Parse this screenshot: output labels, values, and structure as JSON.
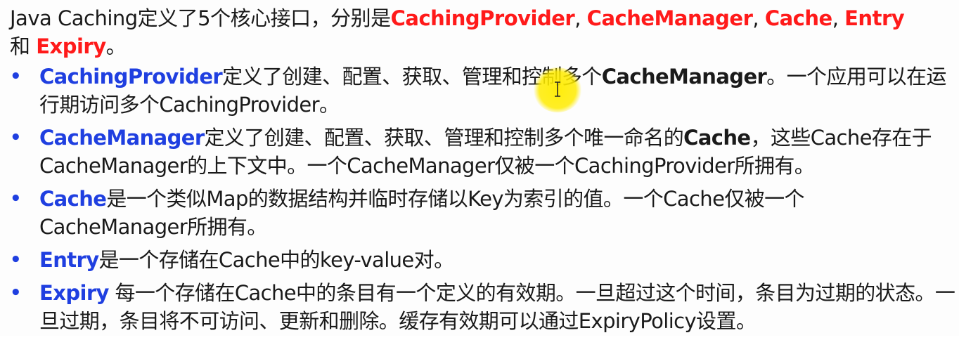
{
  "intro": {
    "prefix": "Java Caching定义了5个核心接口，分别是",
    "terms": [
      "CachingProvider",
      "CacheManager",
      "Cache",
      "Entry",
      "Expiry"
    ],
    "sep1": ", ",
    "sep2": ", ",
    "sep3": ", ",
    "line2_prefix": "和 ",
    "suffix": "。"
  },
  "bullets": [
    {
      "term": "CachingProvider",
      "text1": "定义了创建、配置、获取、管理和控制多个",
      "bold": "CacheManager",
      "text2": "。一个应用可以在运行期访问多个CachingProvider。"
    },
    {
      "term": "CacheManager",
      "text1": "定义了创建、配置、获取、管理和控制多个唯一命名的",
      "bold": "Cache",
      "text2": "，这些Cache存在于CacheManager的上下文中。一个CacheManager仅被一个CachingProvider所拥有。"
    },
    {
      "term": "Cache",
      "text1": "是一个类似Map的数据结构并临时存储以Key为索引的值。一个Cache仅被一个",
      "break_text": "CacheManager所拥有。"
    },
    {
      "term": "Entry",
      "text1": "是一个存储在Cache中的key-value对。"
    },
    {
      "term": "Expiry",
      "text1": " 每一个存储在Cache中的条目有一个定义的有效期。一旦超过这个时间，条目为过期的状态。一旦过期，条目将不可访问、更新和删除。缓存有效期可以通过ExpiryPolicy设置。"
    }
  ],
  "bullet_symbol": "•",
  "colors": {
    "red_term": "#ff1a1a",
    "blue_term": "#1f3fe0",
    "highlight": "#ffec00"
  },
  "icons": {
    "cursor": "text-cursor-icon"
  }
}
